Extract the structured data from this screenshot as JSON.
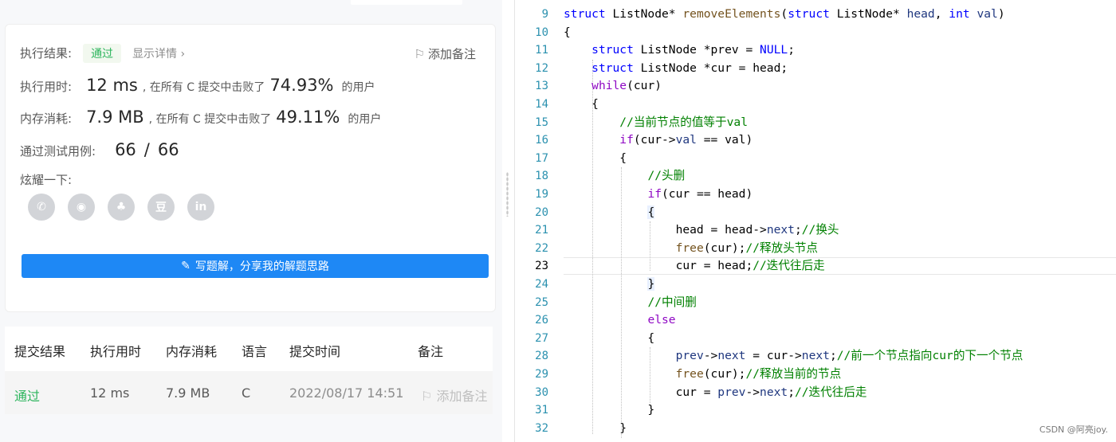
{
  "result_card": {
    "exec_result_label": "执行结果:",
    "status": "通过",
    "show_details": "显示详情",
    "add_note": "添加备注",
    "time_label": "执行用时:",
    "time_value": "12 ms",
    "time_desc": ", 在所有 C 提交中击败了",
    "time_percent": "74.93%",
    "users_suffix": "的用户",
    "mem_label": "内存消耗:",
    "mem_value": "7.9 MB",
    "mem_desc": ", 在所有 C 提交中击败了",
    "mem_percent": "49.11%",
    "tests_label": "通过测试用例:",
    "tests_passed": "66",
    "tests_sep": "/",
    "tests_total": "66",
    "share_label": "炫耀一下:",
    "share_icons": [
      "wechat-icon",
      "weibo-icon",
      "qq-icon",
      "douban-icon",
      "linkedin-icon"
    ],
    "share_glyphs": [
      "✆",
      "◉",
      "♣",
      "豆",
      "in"
    ],
    "write_button": "写题解，分享我的解题思路"
  },
  "submissions": {
    "headers": [
      "提交结果",
      "执行用时",
      "内存消耗",
      "语言",
      "提交时间",
      "备注"
    ],
    "row": {
      "result": "通过",
      "time": "12 ms",
      "memory": "7.9 MB",
      "language": "C",
      "submitted": "2022/08/17 14:51",
      "note": "添加备注"
    }
  },
  "editor": {
    "line_numbers": [
      "9",
      "10",
      "11",
      "12",
      "13",
      "14",
      "15",
      "16",
      "17",
      "18",
      "19",
      "20",
      "21",
      "22",
      "23",
      "24",
      "25",
      "26",
      "27",
      "28",
      "29",
      "30",
      "31",
      "32"
    ],
    "current_line": "23",
    "watermark": "CSDN @阿亮joy."
  },
  "colors": {
    "accent_blue": "#1e88f5",
    "pass_green": "#2db55d",
    "keyword": "#0000ff",
    "control": "#8f08c4",
    "comment": "#008000",
    "line_number": "#2b91af"
  }
}
